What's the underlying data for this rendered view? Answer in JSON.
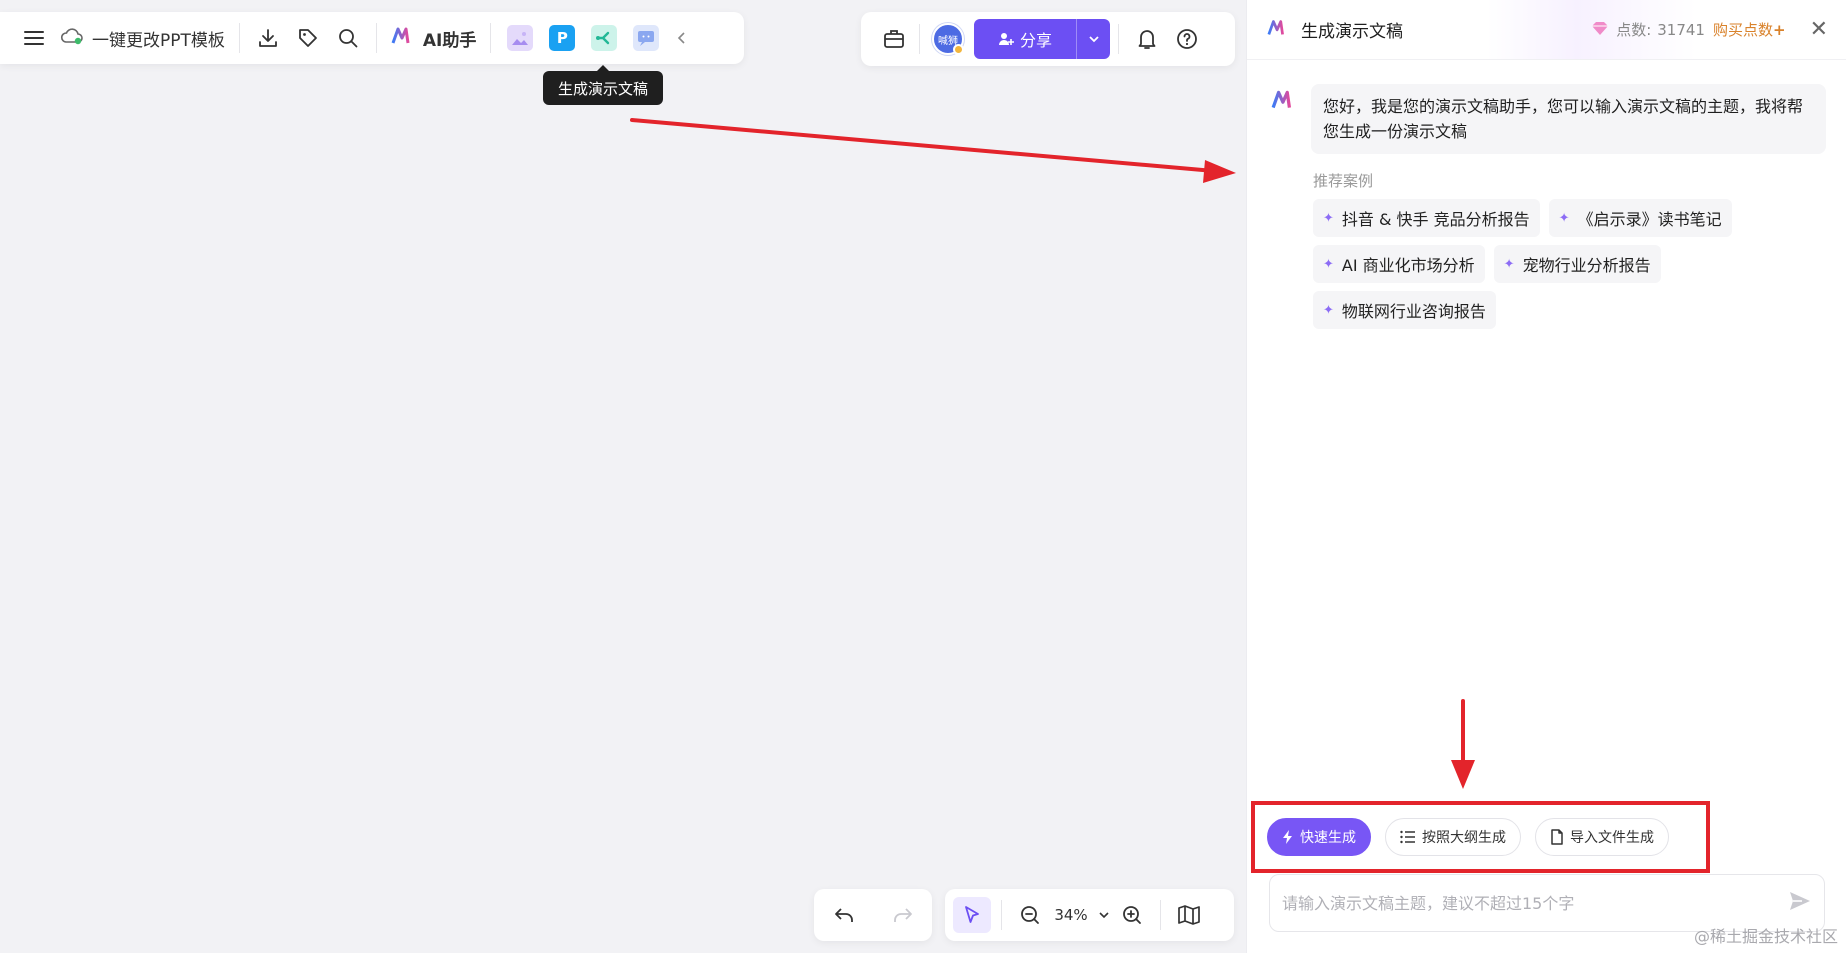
{
  "toolbar": {
    "menu_icon": "hamburger-icon",
    "cloud_icon": "cloud-check-icon",
    "doc_title": "一键更改PPT模板",
    "download_icon": "download-icon",
    "tag_icon": "tag-icon",
    "search_icon": "search-icon",
    "ai_label": "AI助手",
    "apps": [
      {
        "name": "image-gen-app-icon",
        "color": "#d9ccf7"
      },
      {
        "name": "ppt-app-icon",
        "glyph": "P",
        "color": "#1aa1f2"
      },
      {
        "name": "mindmap-app-icon",
        "color": "#2ec4a8"
      },
      {
        "name": "chat-app-icon",
        "color": "#8aa7f0"
      }
    ],
    "collapse_icon": "chevron-left-icon",
    "tooltip": "生成演示文稿"
  },
  "topright": {
    "toolbox_icon": "toolbox-icon",
    "avatar_text": "喊狮",
    "share_label": "分享",
    "bell_icon": "bell-icon",
    "help_icon": "help-icon"
  },
  "bottom": {
    "zoom": "34%"
  },
  "panel": {
    "title": "生成演示文稿",
    "points_label": "点数:",
    "points_value": "31741",
    "buy_label": "购买点数",
    "greeting": "您好，我是您的演示文稿助手，您可以输入演示文稿的主题，我将帮您生成一份演示文稿",
    "rec_label": "推荐案例",
    "chips": [
      "抖音 & 快手 竞品分析报告",
      "《启示录》读书笔记",
      "AI 商业化市场分析",
      "宠物行业分析报告",
      "物联网行业咨询报告"
    ],
    "modes": [
      {
        "label": "快速生成",
        "icon": "lightning-icon"
      },
      {
        "label": "按照大纲生成",
        "icon": "list-icon"
      },
      {
        "label": "导入文件生成",
        "icon": "file-icon"
      }
    ],
    "input_placeholder": "请输入演示文稿主题，建议不超过15个字",
    "send_icon": "send-icon"
  },
  "colors": {
    "brand": "#6c4ff3",
    "annotation": "#e3242b"
  },
  "watermark": "@稀土掘金技术社区"
}
